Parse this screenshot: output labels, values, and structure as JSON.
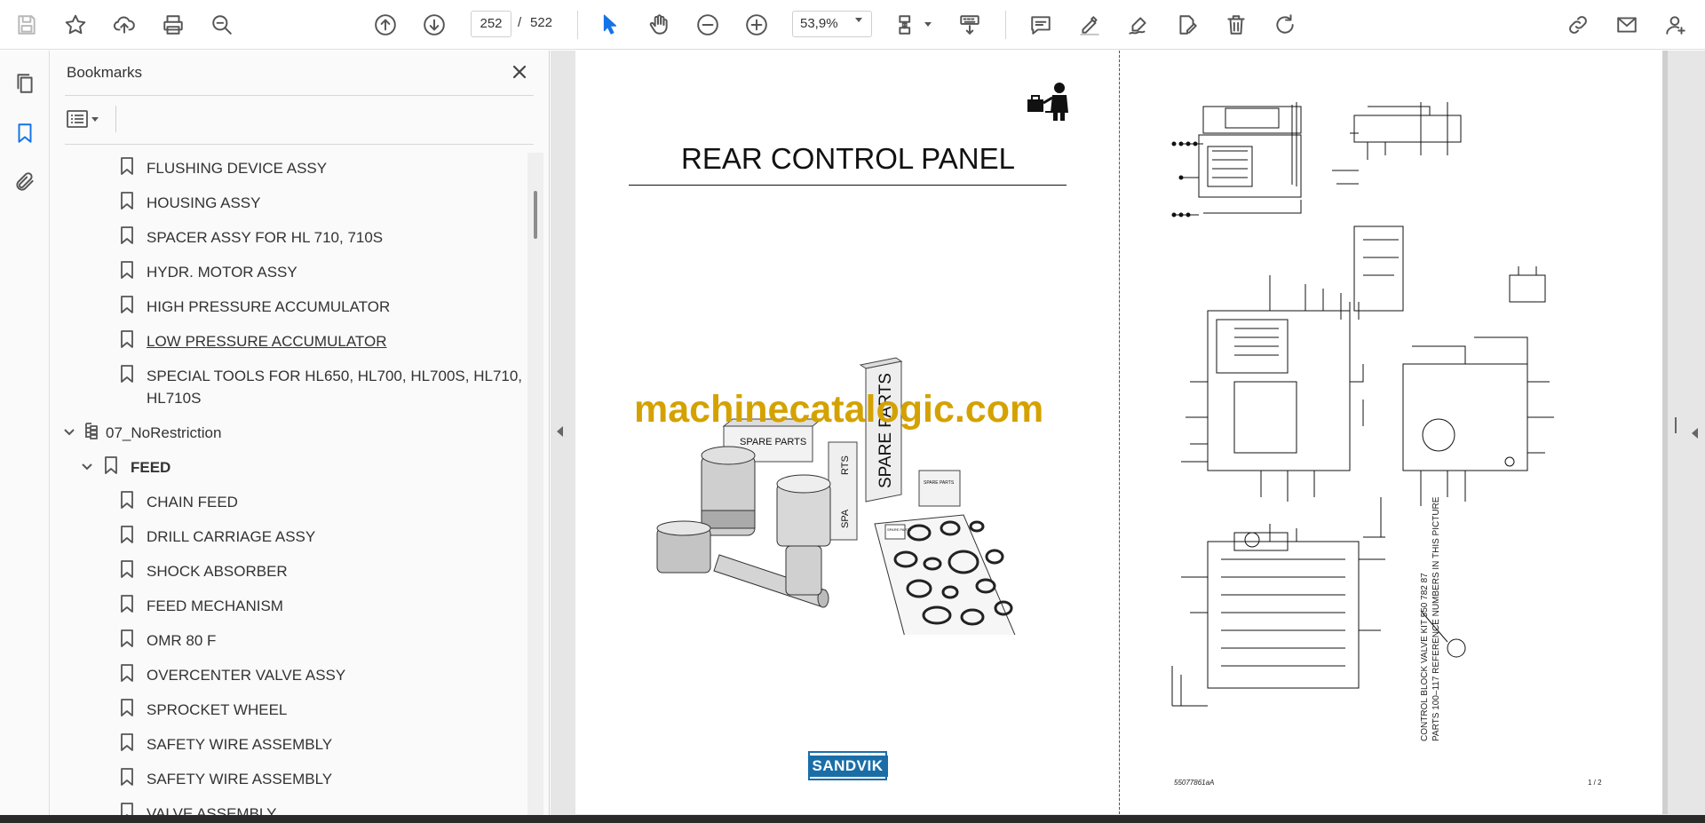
{
  "toolbar": {
    "current_page": "252",
    "page_separator": "/",
    "total_pages": "522",
    "zoom": "53,9%",
    "accent_color": "#1473e6"
  },
  "bookmarks_panel": {
    "title": "Bookmarks",
    "items": [
      {
        "label": "FLUSHING DEVICE ASSY"
      },
      {
        "label": "HOUSING ASSY"
      },
      {
        "label": "SPACER ASSY FOR HL 710, 710S"
      },
      {
        "label": "HYDR. MOTOR ASSY"
      },
      {
        "label": "HIGH PRESSURE ACCUMULATOR"
      },
      {
        "label": "LOW PRESSURE ACCUMULATOR"
      },
      {
        "label": "SPECIAL TOOLS FOR HL650, HL700, HL700S, HL710,",
        "label2": "HL710S"
      },
      {
        "label": "07_NoRestriction"
      },
      {
        "label": "FEED"
      },
      {
        "label": "CHAIN FEED"
      },
      {
        "label": "DRILL CARRIAGE ASSY"
      },
      {
        "label": "SHOCK ABSORBER"
      },
      {
        "label": "FEED MECHANISM"
      },
      {
        "label": "OMR 80 F"
      },
      {
        "label": "OVERCENTER VALVE ASSY"
      },
      {
        "label": "SPROCKET WHEEL"
      },
      {
        "label": "SAFETY WIRE ASSEMBLY"
      },
      {
        "label": "SAFETY WIRE ASSEMBLY"
      },
      {
        "label": "VALVE ASSEMBLY"
      }
    ]
  },
  "document": {
    "left_page": {
      "title": "REAR CONTROL PANEL",
      "watermark": "machinecatalogic.com",
      "brand": "SANDVIK",
      "box_labels": [
        "SPARE PARTS",
        "SPARE PARTS",
        "RTS",
        "SPA",
        "SPARE PARTS",
        "SPARE PARTS"
      ],
      "brand_color": "#1a6ea8",
      "watermark_color": "#d4a200"
    },
    "right_page": {
      "caption_line1": "CONTROL BLOCK VALVE KIT 550 782 87",
      "caption_line2": "PARTS 100–117 REFERENCE NUMBERS IN THIS PICTURE",
      "doc_number": "55077861aA",
      "page_fraction": "1 / 2"
    }
  }
}
